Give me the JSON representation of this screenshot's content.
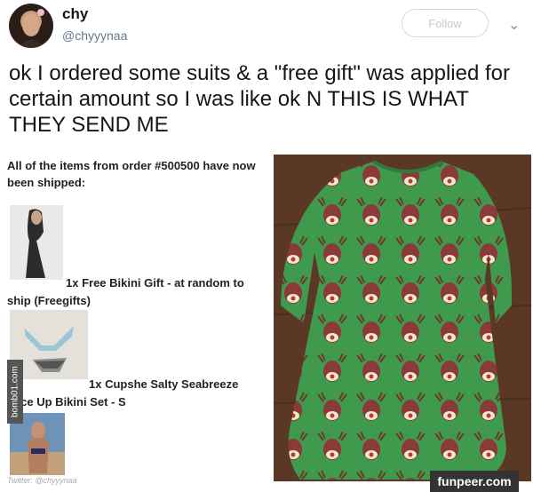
{
  "tweet": {
    "name": "chy",
    "handle": "@chyyynaa",
    "follow_label": "Follow",
    "text": "ok I ordered some suits & a \"free gift\" was applied for certain amount so I was like ok N THIS IS WHAT THEY SEND ME"
  },
  "email": {
    "intro": "All of the items from order #500500 have now been shipped:",
    "items": [
      {
        "text": "1x Free Bikini Gift - at random to ship (Freegifts)"
      },
      {
        "text": "1x Cupshe Salty Seabreeze Lace Up Bikini Set - S"
      }
    ]
  },
  "watermarks": {
    "side": "bomb01.com",
    "credit": "Twitter: @chyyynaa",
    "site": "funpeer.com"
  },
  "icons": {
    "menu": "chevron-down-icon"
  }
}
